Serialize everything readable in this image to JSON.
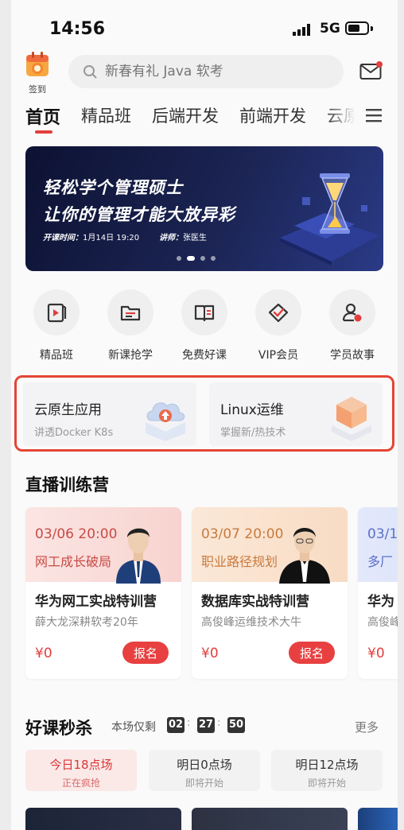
{
  "status_bar": {
    "time": "14:56",
    "network": "5G"
  },
  "header": {
    "checkin_label": "签到",
    "search_placeholder": "新春有礼 Java 软考"
  },
  "tabs": [
    {
      "label": "首页"
    },
    {
      "label": "精品班"
    },
    {
      "label": "后端开发"
    },
    {
      "label": "前端开发"
    },
    {
      "label": "云原"
    }
  ],
  "banner": {
    "line1": "轻松学个管理硕士",
    "line2": "让你的管理才能大放异彩",
    "time_label": "开课时间：",
    "time_value": "1月14日 19:20",
    "lecturer_label": "讲师：",
    "lecturer_value": "张医生"
  },
  "quick_entries": [
    {
      "label": "精品班",
      "icon": "play-book-icon"
    },
    {
      "label": "新课抢学",
      "icon": "folder-icon"
    },
    {
      "label": "免费好课",
      "icon": "open-book-icon"
    },
    {
      "label": "VIP会员",
      "icon": "diamond-icon"
    },
    {
      "label": "学员故事",
      "icon": "person-icon"
    }
  ],
  "promo": [
    {
      "title": "云原生应用",
      "subtitle": "讲透Docker K8s",
      "icon": "cloud-upload-icon"
    },
    {
      "title": "Linux运维",
      "subtitle": "掌握新/热技术",
      "icon": "cube-icon"
    }
  ],
  "live": {
    "title": "直播训练营",
    "cards": [
      {
        "date": "03/06 20:00",
        "tag": "网工成长破局",
        "name": "华为网工实战特训营",
        "sub": "薛大龙深耕软考20年",
        "price": "¥0",
        "button": "报名"
      },
      {
        "date": "03/07 20:00",
        "tag": "职业路径规划",
        "name": "数据库实战特训营",
        "sub": "高俊峰运维技术大牛",
        "price": "¥0",
        "button": "报名"
      },
      {
        "date": "03/1",
        "tag": "多厂",
        "name": "华为",
        "sub": "高俊峰",
        "price": "¥0",
        "button": ""
      }
    ]
  },
  "flash": {
    "title": "好课秒杀",
    "remain_label": "本场仅剩",
    "hours": "02",
    "minutes": "27",
    "seconds": "50",
    "more": "更多",
    "sessions": [
      {
        "title": "今日18点场",
        "status": "正在疯抢"
      },
      {
        "title": "明日0点场",
        "status": "即将开始"
      },
      {
        "title": "明日12点场",
        "status": "即将开始"
      }
    ]
  },
  "colors": {
    "accent": "#e23e3e",
    "promo_border": "#e54535"
  }
}
